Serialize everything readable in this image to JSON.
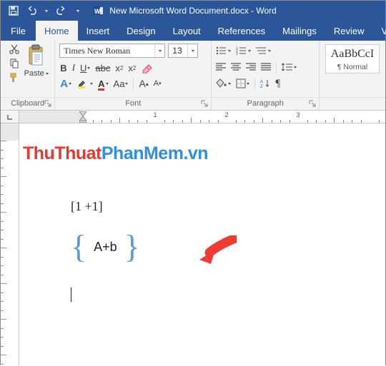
{
  "titlebar": {
    "title": "New Microsoft Word Document.docx - Word"
  },
  "tabs": {
    "file": "File",
    "home": "Home",
    "insert": "Insert",
    "design": "Design",
    "layout": "Layout",
    "references": "References",
    "mailings": "Mailings",
    "review": "Review",
    "view": "View",
    "active": "home"
  },
  "ribbon": {
    "clipboard": {
      "label": "Clipboard",
      "paste": "Paste"
    },
    "font": {
      "label": "Font",
      "name": "Times New Roman",
      "size": "13"
    },
    "paragraph": {
      "label": "Paragraph"
    },
    "styles": {
      "preview": "AaBbCcI",
      "name": "¶ Normal"
    }
  },
  "ruler": {
    "numbers": [
      "1",
      "2",
      "3"
    ]
  },
  "document": {
    "watermark_a": "ThuThuat",
    "watermark_b": "PhanMem.vn",
    "line1": "[1 +1]",
    "line2": "A+b"
  }
}
